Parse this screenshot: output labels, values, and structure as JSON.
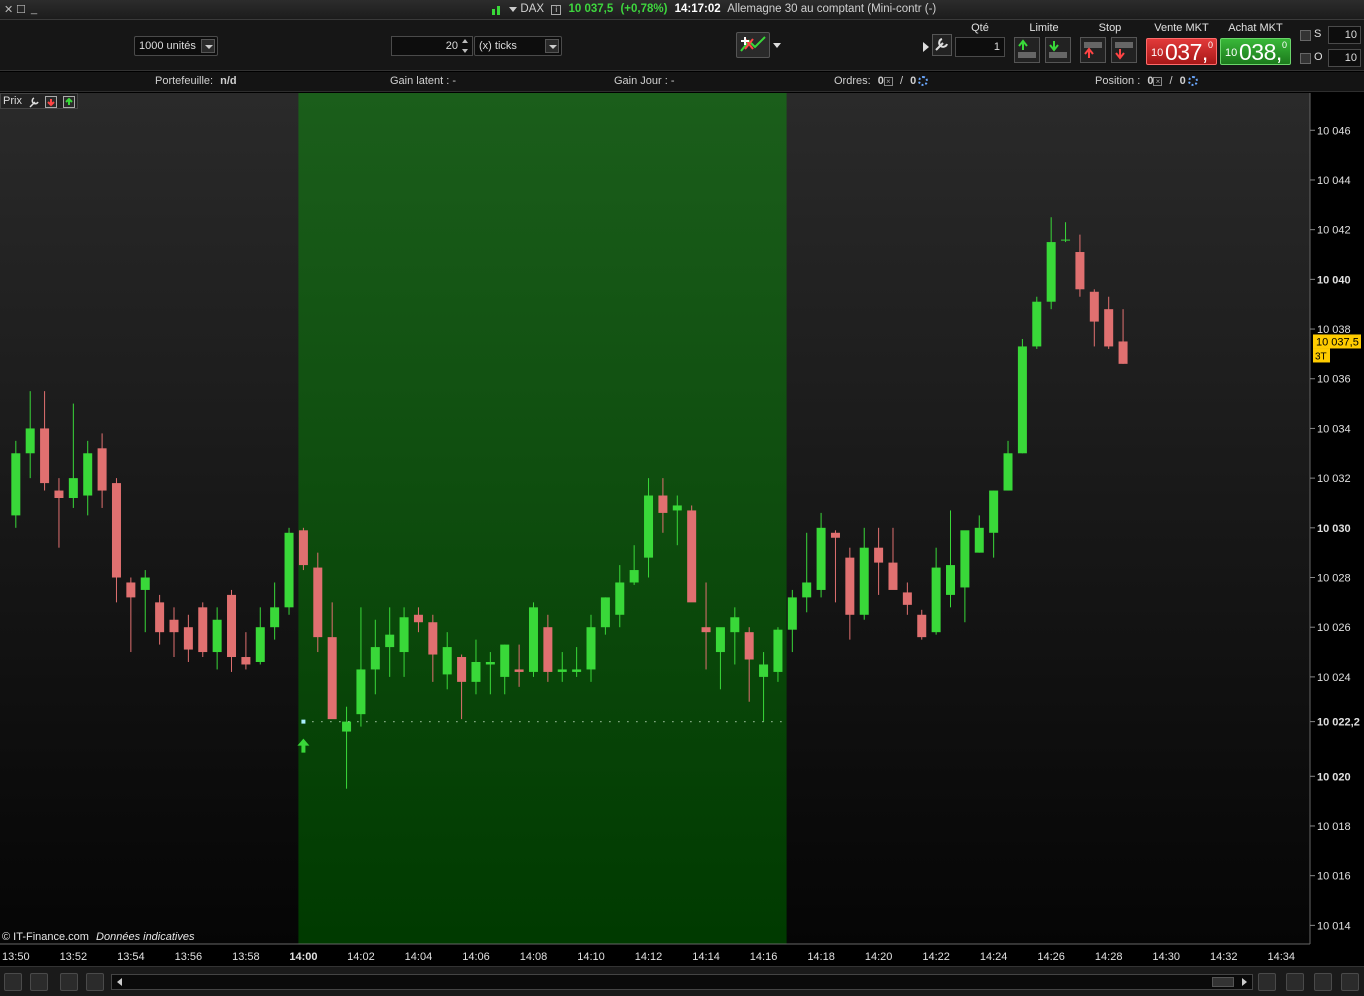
{
  "titlebar": {
    "symbol": "DAX",
    "price": "10 037,5",
    "change": "(+0,78%)",
    "time": "14:17:02",
    "instrument": "Allemagne 30 au comptant (Mini-contr (-)"
  },
  "toolbar": {
    "units_combo": "1000 unités",
    "ticks_value": "20",
    "ticks_combo": "(x) ticks",
    "qty_label": "Qté",
    "qty_value": "1",
    "limit_label": "Limite",
    "stop_label": "Stop",
    "sell_label": "Vente MKT",
    "buy_label": "Achat MKT",
    "sell_price": {
      "small": "10",
      "big": "037,",
      "sup": "0"
    },
    "buy_price": {
      "small": "10",
      "big": "038,",
      "sup": "0"
    },
    "s_label": "S",
    "s_value": "10",
    "o_label": "O",
    "o_value": "10"
  },
  "infobar": {
    "portfolio_label": "Portefeuille:",
    "portfolio_value": "n/d",
    "gain_latent": "Gain latent : -",
    "gain_jour": "Gain Jour : -",
    "orders_label": "Ordres:",
    "orders_a": "0",
    "orders_b": "0",
    "position_label": "Position :",
    "position_a": "0",
    "position_b": "0"
  },
  "chart_panel": {
    "prix_label": "Prix",
    "credit": "© IT-Finance.com",
    "credit_note": "Données indicatives"
  },
  "colors": {
    "up": "#39d839",
    "down": "#e07070",
    "highlight": "#0b5a0b",
    "price_tag": "#ffcc00"
  },
  "chart_data": {
    "type": "candlestick",
    "x_unit": "minutes since 13:50",
    "xlim": [
      -0.55,
      45
    ],
    "ylim": [
      10013.25,
      10047.5
    ],
    "x_ticks": [
      {
        "t": 0,
        "label": "13:50"
      },
      {
        "t": 2,
        "label": "13:52"
      },
      {
        "t": 4,
        "label": "13:54"
      },
      {
        "t": 6,
        "label": "13:56"
      },
      {
        "t": 8,
        "label": "13:58"
      },
      {
        "t": 10,
        "label": "14:00",
        "bold": true
      },
      {
        "t": 12,
        "label": "14:02"
      },
      {
        "t": 14,
        "label": "14:04"
      },
      {
        "t": 16,
        "label": "14:06"
      },
      {
        "t": 18,
        "label": "14:08"
      },
      {
        "t": 20,
        "label": "14:10"
      },
      {
        "t": 22,
        "label": "14:12"
      },
      {
        "t": 24,
        "label": "14:14"
      },
      {
        "t": 26,
        "label": "14:16"
      },
      {
        "t": 28,
        "label": "14:18"
      },
      {
        "t": 30,
        "label": "14:20"
      },
      {
        "t": 32,
        "label": "14:22"
      },
      {
        "t": 34,
        "label": "14:24"
      },
      {
        "t": 36,
        "label": "14:26"
      },
      {
        "t": 38,
        "label": "14:28"
      },
      {
        "t": 40,
        "label": "14:30"
      },
      {
        "t": 42,
        "label": "14:32"
      },
      {
        "t": 44,
        "label": "14:34"
      }
    ],
    "y_ticks": [
      {
        "v": 10014,
        "label": "10 014"
      },
      {
        "v": 10016,
        "label": "10 016"
      },
      {
        "v": 10018,
        "label": "10 018"
      },
      {
        "v": 10020,
        "label": "10 020",
        "bold": true
      },
      {
        "v": 10022.2,
        "label": "10 022,2",
        "bold": true
      },
      {
        "v": 10024,
        "label": "10 024"
      },
      {
        "v": 10026,
        "label": "10 026"
      },
      {
        "v": 10028,
        "label": "10 028"
      },
      {
        "v": 10030,
        "label": "10 030",
        "bold": true
      },
      {
        "v": 10032,
        "label": "10 032"
      },
      {
        "v": 10034,
        "label": "10 034"
      },
      {
        "v": 10036,
        "label": "10 036"
      },
      {
        "v": 10038,
        "label": "10 038"
      },
      {
        "v": 10040,
        "label": "10 040",
        "bold": true
      },
      {
        "v": 10042,
        "label": "10 042"
      },
      {
        "v": 10044,
        "label": "10 044"
      },
      {
        "v": 10046,
        "label": "10 046"
      }
    ],
    "highlight": {
      "from": 10,
      "to": 26.8
    },
    "reference_line": {
      "value": 10022.2,
      "from": 10,
      "to": 26.8
    },
    "last_price": {
      "value": 10037.5,
      "label": "10 037,5",
      "tag": "3T"
    },
    "candles": [
      [
        10030.5,
        10033.5,
        10030.0,
        10033.0
      ],
      [
        10033.0,
        10035.5,
        10032.0,
        10034.0
      ],
      [
        10034.0,
        10035.5,
        10031.5,
        10031.8
      ],
      [
        10031.5,
        10032.0,
        10029.2,
        10031.2
      ],
      [
        10031.2,
        10035.0,
        10030.8,
        10032.0
      ],
      [
        10031.3,
        10033.5,
        10030.5,
        10033.0
      ],
      [
        10033.2,
        10033.8,
        10030.8,
        10031.5
      ],
      [
        10031.8,
        10032.0,
        10027.0,
        10028.0
      ],
      [
        10027.8,
        10028.0,
        10025.0,
        10027.2
      ],
      [
        10027.5,
        10028.3,
        10025.8,
        10028.0
      ],
      [
        10027.0,
        10027.3,
        10025.3,
        10025.8
      ],
      [
        10026.3,
        10026.8,
        10024.8,
        10025.8
      ],
      [
        10026.0,
        10026.5,
        10024.6,
        10025.1
      ],
      [
        10026.8,
        10027.0,
        10024.8,
        10025.0
      ],
      [
        10025.0,
        10026.8,
        10024.3,
        10026.3
      ],
      [
        10027.3,
        10027.5,
        10024.2,
        10024.8
      ],
      [
        10024.8,
        10025.8,
        10024.3,
        10024.5
      ],
      [
        10024.6,
        10026.8,
        10024.5,
        10026.0
      ],
      [
        10026.0,
        10027.8,
        10025.5,
        10026.8
      ],
      [
        10026.8,
        10030.0,
        10026.5,
        10029.8
      ],
      [
        10029.9,
        10030.0,
        10028.3,
        10028.5
      ],
      [
        10028.4,
        10029.0,
        10025.0,
        10025.6
      ],
      [
        10025.6,
        10027.0,
        10022.5,
        10022.3
      ],
      [
        10021.8,
        10022.8,
        10019.5,
        10022.2
      ],
      [
        10022.5,
        10026.8,
        10022.0,
        10024.3
      ],
      [
        10024.3,
        10026.3,
        10023.3,
        10025.2
      ],
      [
        10025.2,
        10026.8,
        10024.0,
        10025.7
      ],
      [
        10025.0,
        10026.8,
        10024.0,
        10026.4
      ],
      [
        10026.5,
        10026.8,
        10025.8,
        10026.2
      ],
      [
        10026.2,
        10026.5,
        10023.8,
        10024.9
      ],
      [
        10024.1,
        10025.8,
        10023.5,
        10025.2
      ],
      [
        10024.8,
        10024.9,
        10022.3,
        10023.8
      ],
      [
        10023.8,
        10025.5,
        10023.3,
        10024.6
      ],
      [
        10024.5,
        10025.0,
        10023.3,
        10024.6
      ],
      [
        10024.0,
        10025.3,
        10023.3,
        10025.3
      ],
      [
        10024.3,
        10025.3,
        10023.6,
        10024.2
      ],
      [
        10024.2,
        10027.0,
        10024.0,
        10026.8
      ],
      [
        10026.0,
        10026.5,
        10023.8,
        10024.2
      ],
      [
        10024.2,
        10025.0,
        10023.8,
        10024.3
      ],
      [
        10024.2,
        10025.2,
        10024.0,
        10024.3
      ],
      [
        10024.3,
        10026.5,
        10023.8,
        10026.0
      ],
      [
        10026.0,
        10027.2,
        10025.7,
        10027.2
      ],
      [
        10026.5,
        10028.5,
        10026.0,
        10027.8
      ],
      [
        10027.8,
        10029.3,
        10027.7,
        10028.3
      ],
      [
        10028.8,
        10032.0,
        10028.0,
        10031.3
      ],
      [
        10031.3,
        10032.0,
        10029.8,
        10030.6
      ],
      [
        10030.7,
        10031.3,
        10029.3,
        10030.9
      ],
      [
        10030.7,
        10030.9,
        10027.2,
        10027.0
      ],
      [
        10026.0,
        10027.8,
        10024.3,
        10025.8
      ],
      [
        10025.0,
        10025.6,
        10023.5,
        10026.0
      ],
      [
        10025.8,
        10026.8,
        10024.5,
        10026.4
      ],
      [
        10025.8,
        10026.0,
        10023.0,
        10024.7
      ],
      [
        10024.0,
        10025.0,
        10022.2,
        10024.5
      ],
      [
        10024.2,
        10026.0,
        10023.8,
        10025.9
      ],
      [
        10025.9,
        10027.5,
        10025.0,
        10027.2
      ],
      [
        10027.2,
        10029.8,
        10026.6,
        10027.8
      ],
      [
        10027.5,
        10030.6,
        10027.2,
        10030.0
      ],
      [
        10029.8,
        10029.9,
        10027.0,
        10029.6
      ],
      [
        10028.8,
        10029.2,
        10025.5,
        10026.5
      ],
      [
        10026.5,
        10030.0,
        10026.3,
        10029.2
      ],
      [
        10029.2,
        10030.0,
        10027.3,
        10028.6
      ],
      [
        10028.6,
        10030.0,
        10028.0,
        10027.5
      ],
      [
        10027.4,
        10027.8,
        10026.5,
        10026.9
      ],
      [
        10026.5,
        10026.7,
        10025.5,
        10025.6
      ],
      [
        10025.8,
        10029.2,
        10025.7,
        10028.4
      ],
      [
        10027.3,
        10030.7,
        10026.8,
        10028.5
      ],
      [
        10027.6,
        10029.5,
        10026.2,
        10029.9
      ],
      [
        10029.0,
        10030.5,
        10029.0,
        10030.0
      ],
      [
        10029.8,
        10031.5,
        10028.8,
        10031.5
      ],
      [
        10031.5,
        10033.5,
        10031.5,
        10033.0
      ],
      [
        10033.0,
        10037.6,
        10033.0,
        10037.3
      ],
      [
        10037.3,
        10039.3,
        10037.2,
        10039.1
      ],
      [
        10039.1,
        10042.5,
        10038.8,
        10041.5
      ],
      [
        10041.6,
        10042.3,
        10041.5,
        10041.6
      ],
      [
        10041.1,
        10041.8,
        10039.3,
        10039.6
      ],
      [
        10039.5,
        10039.6,
        10037.3,
        10038.3
      ],
      [
        10038.8,
        10039.3,
        10037.2,
        10037.3
      ],
      [
        10037.5,
        10038.8,
        10036.6,
        10036.6
      ]
    ]
  }
}
